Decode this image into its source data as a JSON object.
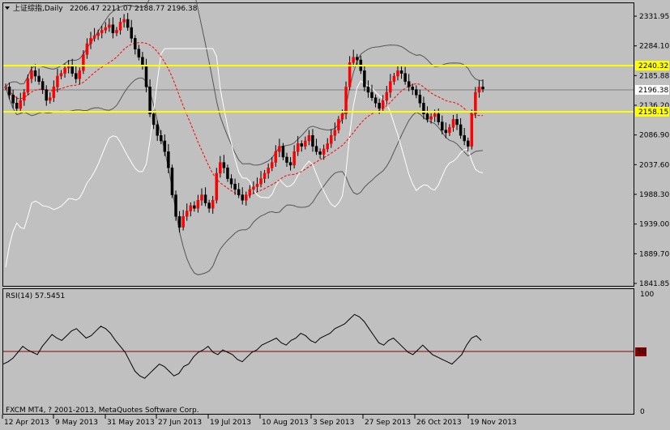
{
  "header": {
    "symbol_timeframe": "上证综指,Daily",
    "ohlc": "2206.47 2211.07 2188.77 2196.38"
  },
  "rsi_panel": {
    "label": "RSI(14) 57.5451",
    "level_label": "50",
    "top_label": "100",
    "bottom_label": "0"
  },
  "copyright": "FXCM MT4, ? 2001-2013, MetaQuotes Software Corp.",
  "price_axis": {
    "ticks": [
      "2331.95",
      "2284.10",
      "2185.88",
      "2136.20",
      "2086.90",
      "2037.60",
      "1988.30",
      "1939.00",
      "1889.70",
      "1841.85"
    ],
    "current_price": "2196.38",
    "resistance_label": "2240.32",
    "support_label": "2158.15"
  },
  "time_axis": {
    "labels": [
      "12 Apr 2013",
      "9 May 2013",
      "31 May 2013",
      "27 Jun 2013",
      "19 Jul 2013",
      "10 Aug 2013",
      "3 Sep 2013",
      "27 Sep 2013",
      "26 Oct 2013",
      "19 Nov 2013"
    ]
  },
  "colors": {
    "background": "#c0c0c0",
    "grid": "#000000",
    "bull_candle": "#ff0000",
    "bear_candle": "#000000",
    "horizontal_line": "#ffff00",
    "ma_line": "#ff0000",
    "bands": "#555555",
    "rsi_line": "#000000",
    "rsi_level": "#8b0000",
    "bandwidth_line": "#ffffff"
  },
  "chart_data": {
    "type": "candlestick",
    "title": "上证综指,Daily",
    "ylim": [
      1841.85,
      2340
    ],
    "horizontal_levels": [
      2240.32,
      2158.15
    ],
    "current_price": 2196.38,
    "candles_close": [
      2200,
      2185,
      2170,
      2160,
      2175,
      2190,
      2215,
      2230,
      2220,
      2210,
      2195,
      2175,
      2180,
      2200,
      2220,
      2225,
      2235,
      2240,
      2225,
      2215,
      2230,
      2260,
      2280,
      2290,
      2295,
      2300,
      2305,
      2310,
      2315,
      2300,
      2305,
      2320,
      2325,
      2310,
      2290,
      2270,
      2255,
      2240,
      2200,
      2150,
      2130,
      2110,
      2100,
      2080,
      2050,
      2000,
      1960,
      1940,
      1960,
      1970,
      1980,
      1975,
      1990,
      2000,
      1985,
      1975,
      1990,
      2040,
      2060,
      2050,
      2030,
      2020,
      2010,
      2000,
      1990,
      2000,
      2010,
      2015,
      2020,
      2030,
      2040,
      2050,
      2060,
      2080,
      2090,
      2070,
      2060,
      2055,
      2080,
      2095,
      2090,
      2100,
      2110,
      2090,
      2080,
      2075,
      2085,
      2095,
      2110,
      2120,
      2140,
      2150,
      2200,
      2245,
      2255,
      2250,
      2230,
      2200,
      2190,
      2180,
      2170,
      2160,
      2175,
      2190,
      2210,
      2220,
      2230,
      2225,
      2210,
      2200,
      2195,
      2185,
      2170,
      2150,
      2140,
      2145,
      2150,
      2135,
      2120,
      2115,
      2125,
      2140,
      2130,
      2110,
      2100,
      2090,
      2150,
      2190,
      2200,
      2196
    ],
    "rsi": {
      "name": "RSI(14)",
      "last": 57.5451,
      "level": 50,
      "range": [
        0,
        100
      ],
      "values": [
        40,
        42,
        45,
        50,
        55,
        52,
        50,
        48,
        55,
        60,
        65,
        62,
        60,
        64,
        68,
        70,
        66,
        62,
        64,
        68,
        72,
        70,
        66,
        60,
        55,
        50,
        42,
        34,
        30,
        28,
        32,
        36,
        40,
        38,
        34,
        30,
        32,
        38,
        40,
        46,
        50,
        52,
        55,
        50,
        48,
        52,
        50,
        48,
        44,
        42,
        46,
        50,
        52,
        56,
        58,
        60,
        62,
        58,
        56,
        60,
        62,
        66,
        64,
        60,
        58,
        62,
        64,
        66,
        70,
        72,
        74,
        78,
        82,
        80,
        76,
        70,
        64,
        58,
        56,
        60,
        62,
        58,
        54,
        50,
        48,
        52,
        56,
        52,
        48,
        46,
        44,
        42,
        40,
        44,
        48,
        56,
        62,
        64,
        60
      ]
    }
  }
}
